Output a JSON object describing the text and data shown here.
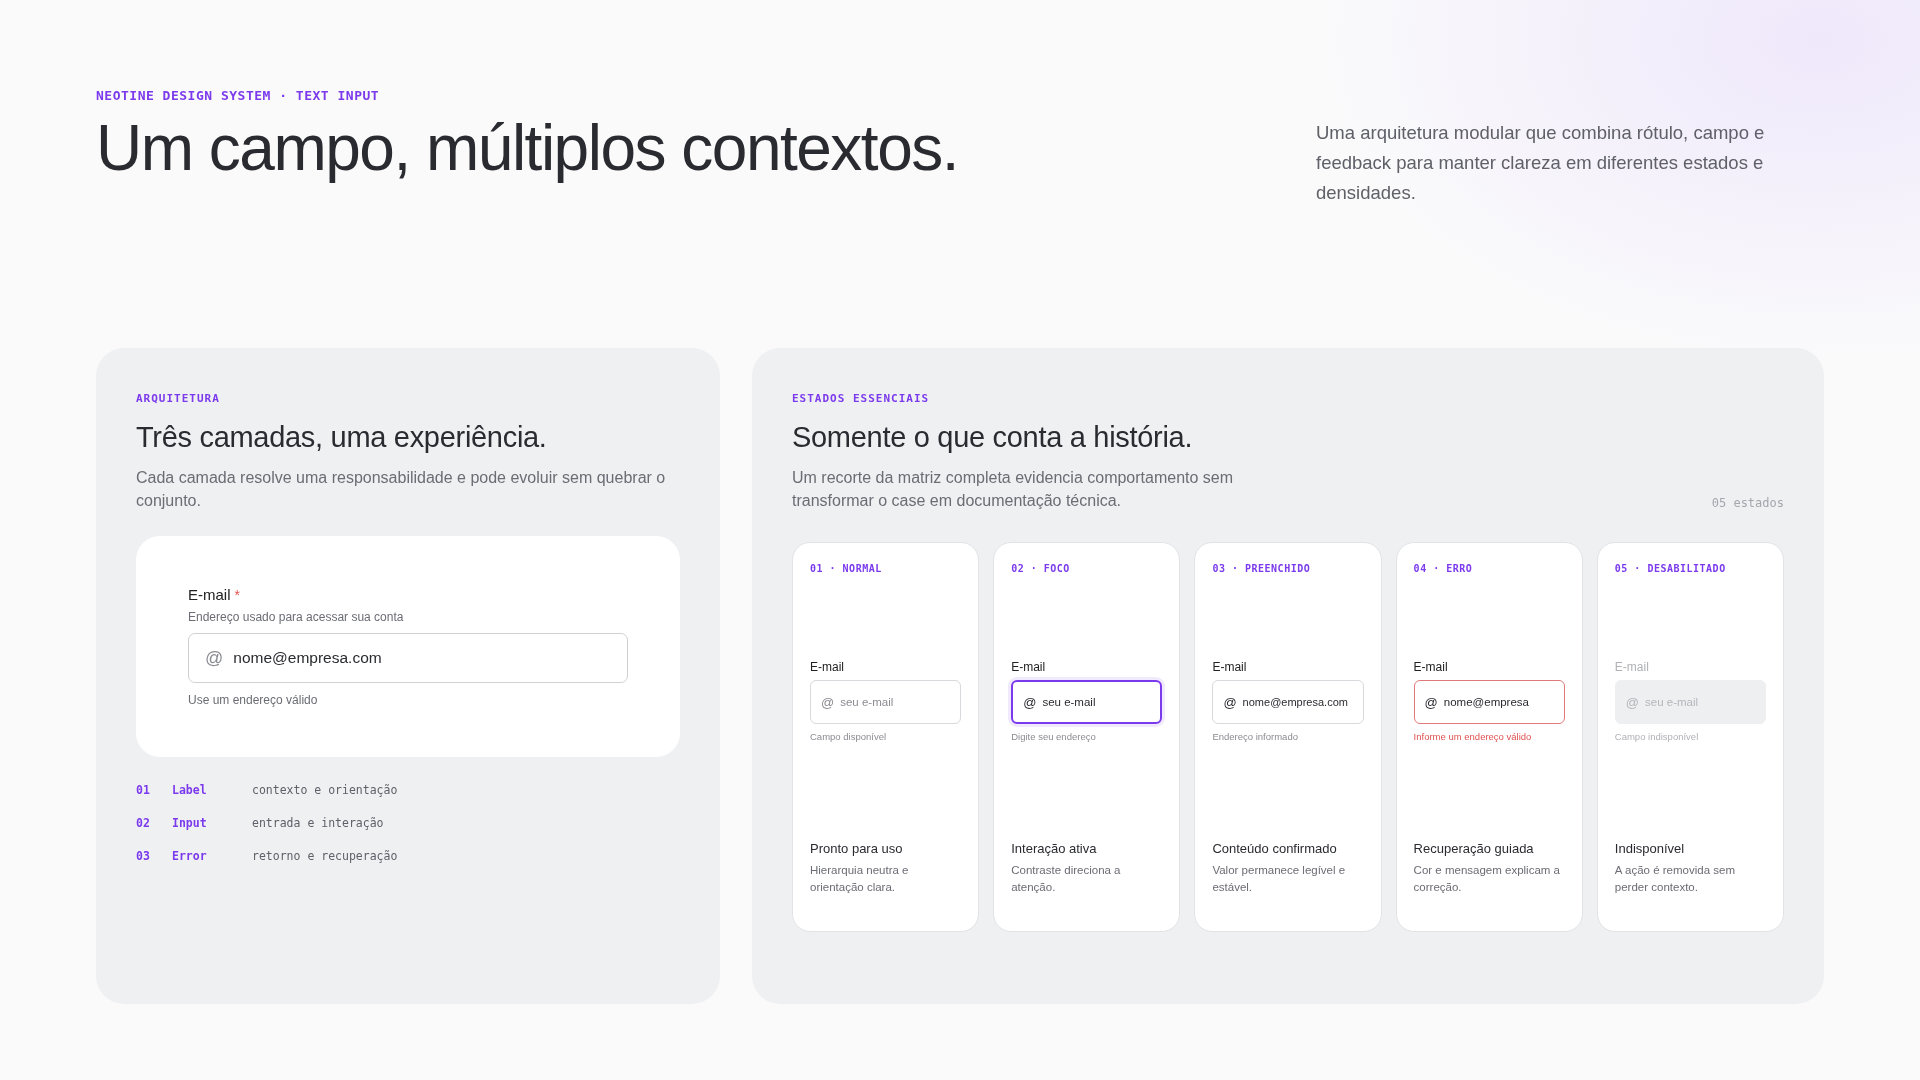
{
  "header": {
    "eyebrow": "NEOTINE DESIGN SYSTEM · TEXT INPUT",
    "title": "Um campo, múltiplos contextos.",
    "intro": "Uma arquitetura modular que combina rótulo, campo e feedback para manter clareza em diferentes estados e densidades."
  },
  "architecture": {
    "eyebrow": "ARQUITETURA",
    "title": "Três camadas, uma experiência.",
    "description": "Cada camada resolve uma responsabilidade e pode evoluir sem quebrar o conjunto.",
    "example": {
      "label": "E-mail",
      "required_mark": "*",
      "hint": "Endereço usado para acessar sua conta",
      "icon": "@",
      "value": "nome@empresa.com",
      "helper": "Use um endereço válido"
    },
    "layers": [
      {
        "number": "01",
        "name": "Label",
        "role": "contexto e orientação"
      },
      {
        "number": "02",
        "name": "Input",
        "role": "entrada e interação"
      },
      {
        "number": "03",
        "name": "Error",
        "role": "retorno e recuperação"
      }
    ]
  },
  "states": {
    "eyebrow": "ESTADOS ESSENCIAIS",
    "title": "Somente o que conta a história.",
    "description": "Um recorte da matriz completa evidencia comportamento sem transformar o case em documentação técnica.",
    "count": "05 estados",
    "cards": [
      {
        "kind": "normal",
        "tag": "01 · NORMAL",
        "label": "E-mail",
        "icon": "@",
        "placeholder": "seu e-mail",
        "helper": "Campo disponível",
        "title": "Pronto para uso",
        "text": "Hierarquia neutra e orientação clara."
      },
      {
        "kind": "focus",
        "tag": "02 · FOCO",
        "label": "E-mail",
        "icon": "@",
        "placeholder": "seu e-mail",
        "helper": "Digite seu endereço",
        "title": "Interação ativa",
        "text": "Contraste direciona a atenção."
      },
      {
        "kind": "filled",
        "tag": "03 · PREENCHIDO",
        "label": "E-mail",
        "icon": "@",
        "value": "nome@empresa.com",
        "helper": "Endereço informado",
        "title": "Conteúdo confirmado",
        "text": "Valor permanece legível e estável."
      },
      {
        "kind": "error",
        "tag": "04 · ERRO",
        "label": "E-mail",
        "icon": "@",
        "value": "nome@empresa",
        "helper": "Informe um endereço válido",
        "title": "Recuperação guiada",
        "text": "Cor e mensagem explicam a correção."
      },
      {
        "kind": "disabled",
        "tag": "05 · DESABILITADO",
        "label": "E-mail",
        "icon": "@",
        "placeholder": "seu e-mail",
        "helper": "Campo indisponível",
        "title": "Indisponível",
        "text": "A ação é removida sem perder contexto."
      }
    ]
  }
}
